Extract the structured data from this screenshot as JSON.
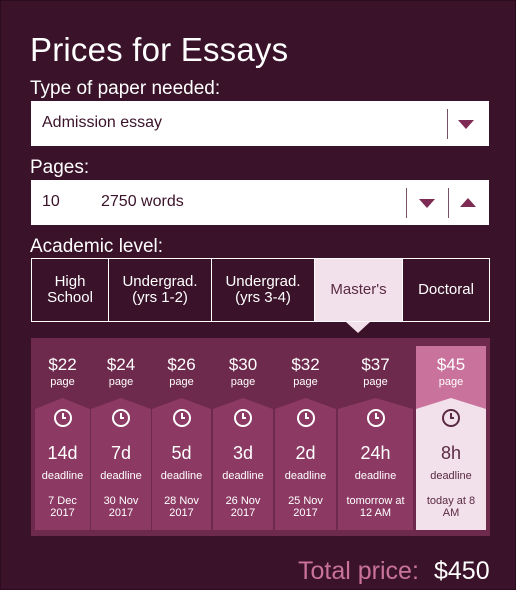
{
  "title": "Prices for Essays",
  "paper_type": {
    "label": "Type of paper needed:",
    "value": "Admission essay"
  },
  "pages": {
    "label": "Pages:",
    "count": "10",
    "words": "2750 words"
  },
  "academic_level": {
    "label": "Academic level:",
    "selected": "Master's",
    "options": [
      "High School",
      "Undergrad. (yrs 1-2)",
      "Undergrad. (yrs 3-4)",
      "Master's",
      "Doctoral"
    ]
  },
  "deadlines": [
    {
      "price": "$22",
      "unit": "page",
      "duration": "14d",
      "label": "deadline",
      "date": "7 Dec 2017"
    },
    {
      "price": "$24",
      "unit": "page",
      "duration": "7d",
      "label": "deadline",
      "date": "30 Nov 2017"
    },
    {
      "price": "$26",
      "unit": "page",
      "duration": "5d",
      "label": "deadline",
      "date": "28 Nov 2017"
    },
    {
      "price": "$30",
      "unit": "page",
      "duration": "3d",
      "label": "deadline",
      "date": "26 Nov 2017"
    },
    {
      "price": "$32",
      "unit": "page",
      "duration": "2d",
      "label": "deadline",
      "date": "25 Nov 2017"
    },
    {
      "price": "$37",
      "unit": "page",
      "duration": "24h",
      "label": "deadline",
      "date": "tomorrow at 12 AM"
    },
    {
      "price": "$45",
      "unit": "page",
      "duration": "8h",
      "label": "deadline",
      "date": "today at 8 AM"
    }
  ],
  "selected_deadline": 6,
  "total": {
    "label": "Total price:",
    "value": "$450"
  },
  "colors": {
    "background": "#3a1229",
    "accent": "#c9729b",
    "card": "#8c3a63",
    "selected_light": "#f2e1ea"
  }
}
